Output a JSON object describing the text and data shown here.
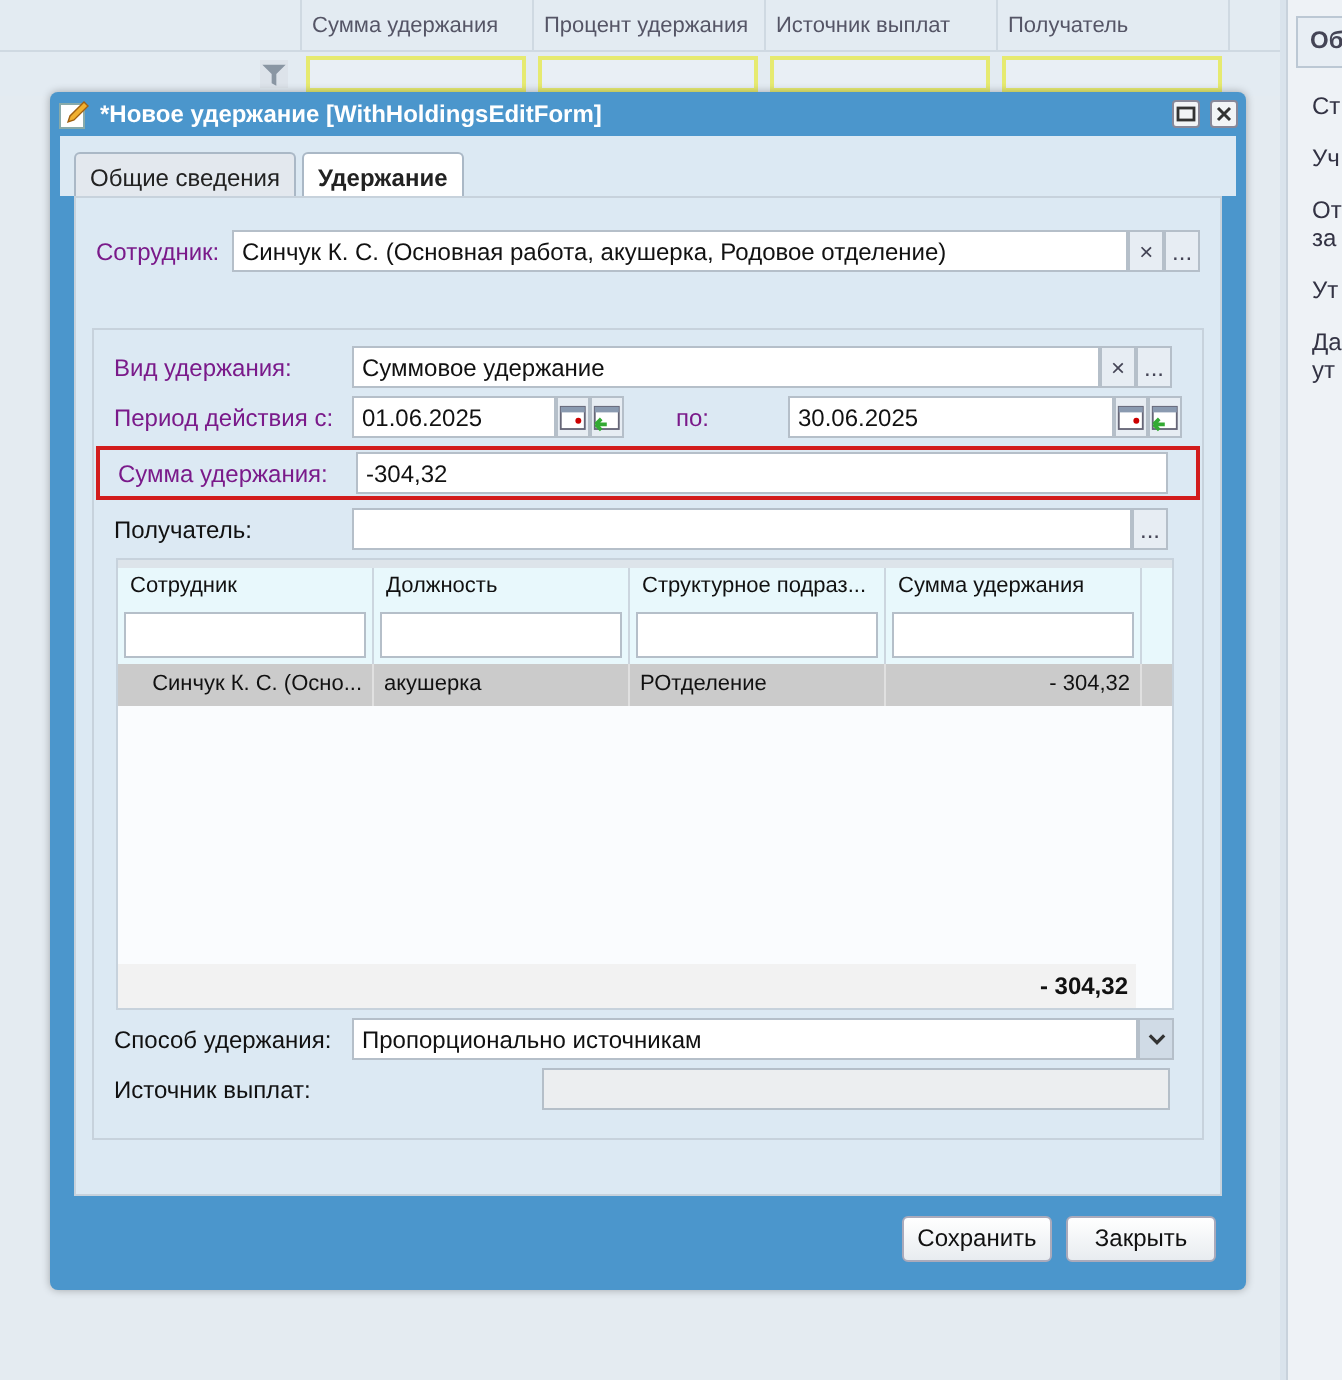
{
  "background_grid": {
    "columns": [
      "Сумма удержания",
      "Процент удержания",
      "Источник выплат",
      "Получатель"
    ]
  },
  "side_panel": {
    "tab": "Об",
    "items": [
      [
        "Ст"
      ],
      [
        "Уч"
      ],
      [
        "От",
        "за"
      ],
      [
        "Ут"
      ],
      [
        "Да",
        "ут"
      ]
    ]
  },
  "dialog": {
    "title": "*Новое удержание [WithHoldingsEditForm]",
    "tabs": [
      {
        "label": "Общие сведения",
        "selected": false
      },
      {
        "label": "Удержание",
        "selected": true
      }
    ],
    "employee": {
      "label": "Сотрудник:",
      "value": "Синчук К. С. (Основная работа, акушерка, Родовое отделение)",
      "required": true,
      "buttons": [
        "×",
        "..."
      ]
    },
    "withholding_type": {
      "label": "Вид удержания:",
      "value": "Суммовое удержание",
      "required": true,
      "buttons": [
        "×",
        "..."
      ]
    },
    "period": {
      "label": "Период действия с:",
      "from": "01.06.2025",
      "to_label": "по:",
      "to": "30.06.2025",
      "required": true
    },
    "amount": {
      "label": "Сумма удержания:",
      "value": "-304,32",
      "required": true,
      "highlighted": true
    },
    "recipient": {
      "label": "Получатель:",
      "required": false,
      "buttons": [
        "..."
      ]
    },
    "table": {
      "columns": [
        "Сотрудник",
        "Должность",
        "Структурное подраз...",
        "Сумма удержания"
      ],
      "rows": [
        {
          "cells": [
            "Синчук К. С. (Осно...",
            "акушерка",
            "РОтделение",
            "- 304,32"
          ],
          "selected": true
        }
      ],
      "total": "- 304,32"
    },
    "method": {
      "label": "Способ удержания:",
      "value": "Пропорционально источникам"
    },
    "source": {
      "label": "Источник выплат:",
      "disabled": true
    },
    "buttons": [
      "Сохранить",
      "Закрыть"
    ]
  }
}
